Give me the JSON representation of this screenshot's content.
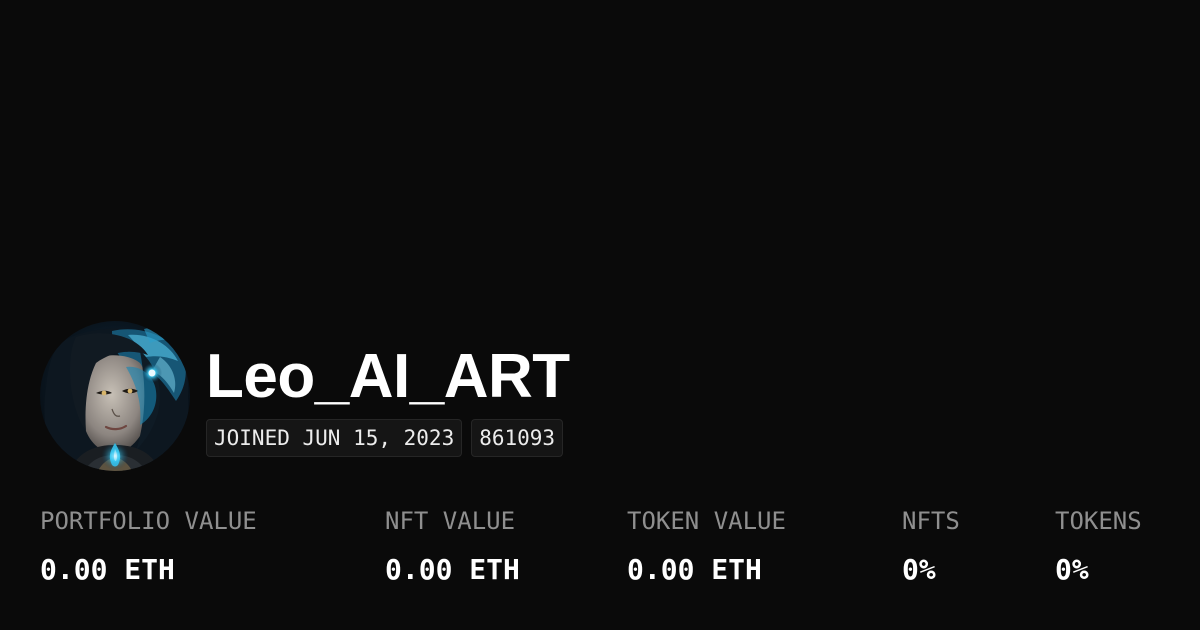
{
  "profile": {
    "username": "Leo_AI_ART",
    "avatar": "ai-art-portrait-avatar",
    "joined": "JOINED JUN 15, 2023",
    "id": "861093"
  },
  "stats": [
    {
      "label": "PORTFOLIO VALUE",
      "value": "0.00 ETH"
    },
    {
      "label": "NFT VALUE",
      "value": "0.00 ETH"
    },
    {
      "label": "TOKEN VALUE",
      "value": "0.00 ETH"
    },
    {
      "label": "NFTS",
      "value": "0%"
    },
    {
      "label": "TOKENS",
      "value": "0%"
    }
  ],
  "colors": {
    "background": "#0a0a0a",
    "text": "#ffffff",
    "label": "#8f8f8f",
    "badge_bg": "#151515",
    "avatar_accent": "#3cc8f0"
  }
}
